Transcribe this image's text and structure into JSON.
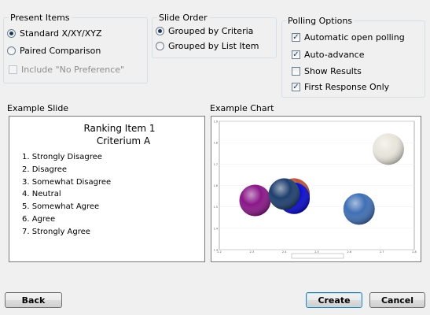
{
  "present_items": {
    "title": "Present Items",
    "options": [
      {
        "label": "Standard X/XY/XYZ",
        "selected": true
      },
      {
        "label": "Paired Comparison",
        "selected": false
      }
    ],
    "include_no_pref": {
      "label": "Include \"No Preference\"",
      "checked": false,
      "disabled": true
    }
  },
  "slide_order": {
    "title": "Slide Order",
    "options": [
      {
        "label": "Grouped by Criteria",
        "selected": true
      },
      {
        "label": "Grouped by List Item",
        "selected": false
      }
    ]
  },
  "polling_options": {
    "title": "Polling Options",
    "options": [
      {
        "label": "Automatic open polling",
        "checked": true
      },
      {
        "label": "Auto-advance",
        "checked": true
      },
      {
        "label": "Show Results",
        "checked": false
      },
      {
        "label": "First Response Only",
        "checked": true
      }
    ]
  },
  "example_slide": {
    "label": "Example Slide",
    "title_line1": "Ranking Item 1",
    "title_line2": "Criterium A",
    "items": [
      "1.  Strongly Disagree",
      "2.  Disagree",
      "3.  Somewhat Disagree",
      "4.  Neutral",
      "5.  Somewhat Agree",
      "6.  Agree",
      "7.  Strongly Agree"
    ]
  },
  "example_chart": {
    "label": "Example Chart"
  },
  "chart_data": {
    "type": "scatter",
    "title": "",
    "xlabel": "",
    "ylabel": "",
    "xlim": [
      2.2,
      2.8
    ],
    "ylim": [
      1.3,
      1.9
    ],
    "x_ticks": [
      "2.2",
      "2.3",
      "2.4",
      "2.5",
      "2.6",
      "2.7",
      "2.8"
    ],
    "y_ticks": [
      "1.3",
      "1.4",
      "1.5",
      "1.6",
      "1.7",
      "1.8",
      "1.9"
    ],
    "points": [
      {
        "x": 2.72,
        "y": 1.77,
        "color": "#e8e6dc"
      },
      {
        "x": 2.31,
        "y": 1.53,
        "color": "#8a1788"
      },
      {
        "x": 2.43,
        "y": 1.56,
        "color": "#b5583f"
      },
      {
        "x": 2.43,
        "y": 1.54,
        "color": "#0a0ad0"
      },
      {
        "x": 2.4,
        "y": 1.56,
        "color": "#1f3f6e"
      },
      {
        "x": 2.63,
        "y": 1.49,
        "color": "#3f6fb5"
      }
    ],
    "legend_position": "bottom"
  },
  "buttons": {
    "back": "Back",
    "create": "Create",
    "cancel": "Cancel"
  }
}
